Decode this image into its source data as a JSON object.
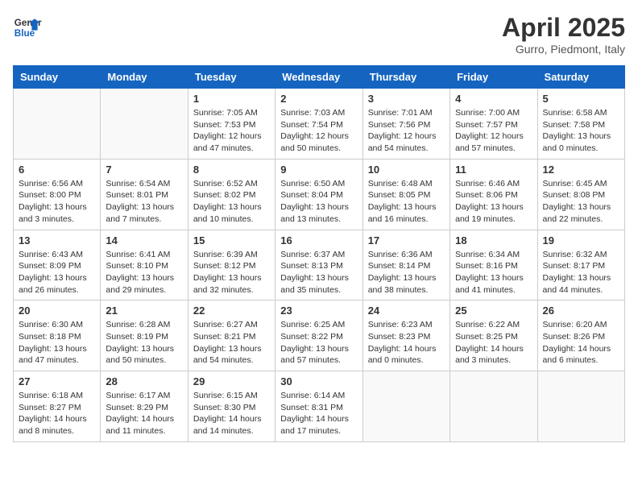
{
  "logo": {
    "line1": "General",
    "line2": "Blue"
  },
  "title": "April 2025",
  "subtitle": "Gurro, Piedmont, Italy",
  "days_of_week": [
    "Sunday",
    "Monday",
    "Tuesday",
    "Wednesday",
    "Thursday",
    "Friday",
    "Saturday"
  ],
  "weeks": [
    [
      {
        "day": "",
        "info": ""
      },
      {
        "day": "",
        "info": ""
      },
      {
        "day": "1",
        "info": "Sunrise: 7:05 AM\nSunset: 7:53 PM\nDaylight: 12 hours and 47 minutes."
      },
      {
        "day": "2",
        "info": "Sunrise: 7:03 AM\nSunset: 7:54 PM\nDaylight: 12 hours and 50 minutes."
      },
      {
        "day": "3",
        "info": "Sunrise: 7:01 AM\nSunset: 7:56 PM\nDaylight: 12 hours and 54 minutes."
      },
      {
        "day": "4",
        "info": "Sunrise: 7:00 AM\nSunset: 7:57 PM\nDaylight: 12 hours and 57 minutes."
      },
      {
        "day": "5",
        "info": "Sunrise: 6:58 AM\nSunset: 7:58 PM\nDaylight: 13 hours and 0 minutes."
      }
    ],
    [
      {
        "day": "6",
        "info": "Sunrise: 6:56 AM\nSunset: 8:00 PM\nDaylight: 13 hours and 3 minutes."
      },
      {
        "day": "7",
        "info": "Sunrise: 6:54 AM\nSunset: 8:01 PM\nDaylight: 13 hours and 7 minutes."
      },
      {
        "day": "8",
        "info": "Sunrise: 6:52 AM\nSunset: 8:02 PM\nDaylight: 13 hours and 10 minutes."
      },
      {
        "day": "9",
        "info": "Sunrise: 6:50 AM\nSunset: 8:04 PM\nDaylight: 13 hours and 13 minutes."
      },
      {
        "day": "10",
        "info": "Sunrise: 6:48 AM\nSunset: 8:05 PM\nDaylight: 13 hours and 16 minutes."
      },
      {
        "day": "11",
        "info": "Sunrise: 6:46 AM\nSunset: 8:06 PM\nDaylight: 13 hours and 19 minutes."
      },
      {
        "day": "12",
        "info": "Sunrise: 6:45 AM\nSunset: 8:08 PM\nDaylight: 13 hours and 22 minutes."
      }
    ],
    [
      {
        "day": "13",
        "info": "Sunrise: 6:43 AM\nSunset: 8:09 PM\nDaylight: 13 hours and 26 minutes."
      },
      {
        "day": "14",
        "info": "Sunrise: 6:41 AM\nSunset: 8:10 PM\nDaylight: 13 hours and 29 minutes."
      },
      {
        "day": "15",
        "info": "Sunrise: 6:39 AM\nSunset: 8:12 PM\nDaylight: 13 hours and 32 minutes."
      },
      {
        "day": "16",
        "info": "Sunrise: 6:37 AM\nSunset: 8:13 PM\nDaylight: 13 hours and 35 minutes."
      },
      {
        "day": "17",
        "info": "Sunrise: 6:36 AM\nSunset: 8:14 PM\nDaylight: 13 hours and 38 minutes."
      },
      {
        "day": "18",
        "info": "Sunrise: 6:34 AM\nSunset: 8:16 PM\nDaylight: 13 hours and 41 minutes."
      },
      {
        "day": "19",
        "info": "Sunrise: 6:32 AM\nSunset: 8:17 PM\nDaylight: 13 hours and 44 minutes."
      }
    ],
    [
      {
        "day": "20",
        "info": "Sunrise: 6:30 AM\nSunset: 8:18 PM\nDaylight: 13 hours and 47 minutes."
      },
      {
        "day": "21",
        "info": "Sunrise: 6:28 AM\nSunset: 8:19 PM\nDaylight: 13 hours and 50 minutes."
      },
      {
        "day": "22",
        "info": "Sunrise: 6:27 AM\nSunset: 8:21 PM\nDaylight: 13 hours and 54 minutes."
      },
      {
        "day": "23",
        "info": "Sunrise: 6:25 AM\nSunset: 8:22 PM\nDaylight: 13 hours and 57 minutes."
      },
      {
        "day": "24",
        "info": "Sunrise: 6:23 AM\nSunset: 8:23 PM\nDaylight: 14 hours and 0 minutes."
      },
      {
        "day": "25",
        "info": "Sunrise: 6:22 AM\nSunset: 8:25 PM\nDaylight: 14 hours and 3 minutes."
      },
      {
        "day": "26",
        "info": "Sunrise: 6:20 AM\nSunset: 8:26 PM\nDaylight: 14 hours and 6 minutes."
      }
    ],
    [
      {
        "day": "27",
        "info": "Sunrise: 6:18 AM\nSunset: 8:27 PM\nDaylight: 14 hours and 8 minutes."
      },
      {
        "day": "28",
        "info": "Sunrise: 6:17 AM\nSunset: 8:29 PM\nDaylight: 14 hours and 11 minutes."
      },
      {
        "day": "29",
        "info": "Sunrise: 6:15 AM\nSunset: 8:30 PM\nDaylight: 14 hours and 14 minutes."
      },
      {
        "day": "30",
        "info": "Sunrise: 6:14 AM\nSunset: 8:31 PM\nDaylight: 14 hours and 17 minutes."
      },
      {
        "day": "",
        "info": ""
      },
      {
        "day": "",
        "info": ""
      },
      {
        "day": "",
        "info": ""
      }
    ]
  ]
}
